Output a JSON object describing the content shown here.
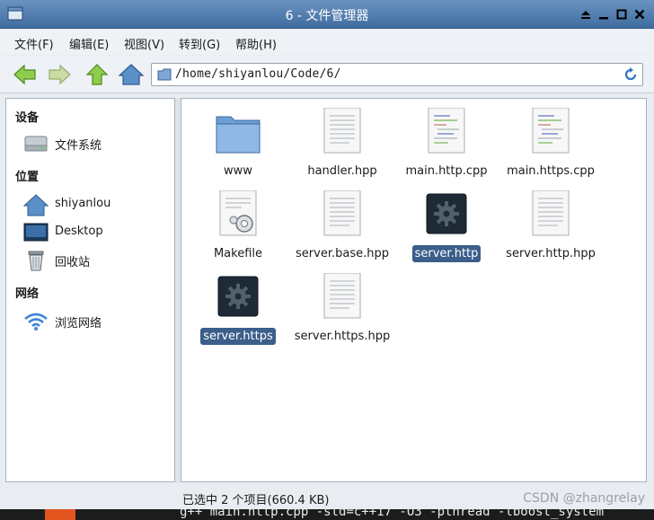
{
  "window": {
    "title": "6 - 文件管理器"
  },
  "menu": [
    "文件(F)",
    "编辑(E)",
    "视图(V)",
    "转到(G)",
    "帮助(H)"
  ],
  "address": {
    "path": "/home/shiyanlou/Code/6/"
  },
  "sidebar": {
    "devices": {
      "heading": "设备",
      "items": [
        {
          "label": "文件系统",
          "icon": "drive-icon"
        }
      ]
    },
    "places": {
      "heading": "位置",
      "items": [
        {
          "label": "shiyanlou",
          "icon": "home-icon"
        },
        {
          "label": "Desktop",
          "icon": "desktop-icon"
        },
        {
          "label": "回收站",
          "icon": "trash-icon"
        }
      ]
    },
    "network": {
      "heading": "网络",
      "items": [
        {
          "label": "浏览网络",
          "icon": "wifi-icon"
        }
      ]
    }
  },
  "files": [
    {
      "name": "www",
      "type": "folder",
      "selected": false
    },
    {
      "name": "handler.hpp",
      "type": "text",
      "selected": false
    },
    {
      "name": "main.http.cpp",
      "type": "code",
      "selected": false
    },
    {
      "name": "main.https.cpp",
      "type": "code",
      "selected": false
    },
    {
      "name": "Makefile",
      "type": "makefile",
      "selected": false
    },
    {
      "name": "server.base.hpp",
      "type": "text",
      "selected": false
    },
    {
      "name": "server.http",
      "type": "executable",
      "selected": true
    },
    {
      "name": "server.http.hpp",
      "type": "text",
      "selected": false
    },
    {
      "name": "server.https",
      "type": "executable",
      "selected": true
    },
    {
      "name": "server.https.hpp",
      "type": "text",
      "selected": false
    }
  ],
  "status": {
    "text": "已选中 2 个项目(660.4 KB)",
    "watermark": "CSDN @zhangrelay"
  },
  "terminal": {
    "text": "g++ main.http.cpp -std=c++17 -O3 -pthread -lboost_system"
  },
  "colors": {
    "titlebar": "#4f7aad",
    "selection": "#3b5e8a",
    "arrow_green": "#7cc242",
    "folder_blue": "#5b8fca"
  }
}
